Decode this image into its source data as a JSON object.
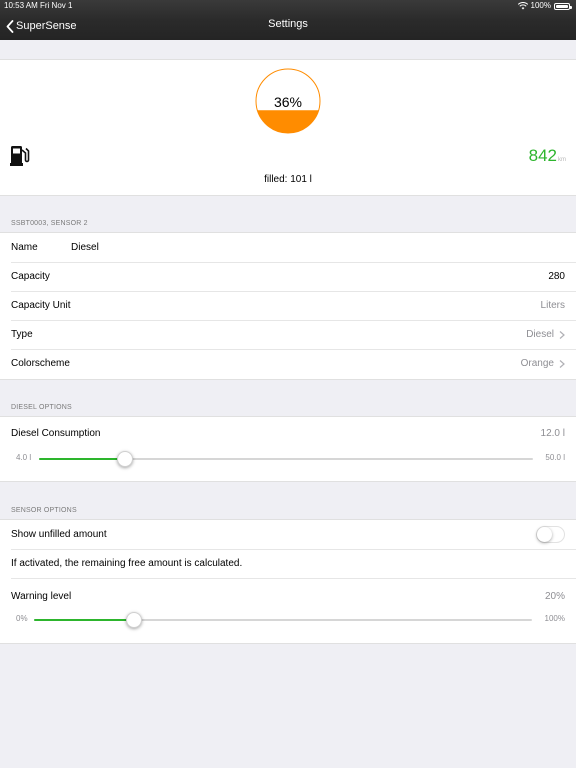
{
  "status_bar": {
    "time": "10:53 AM",
    "date": "Fri Nov 1",
    "battery": "100%"
  },
  "nav": {
    "back_label": "SuperSense",
    "title": "Settings"
  },
  "gauge": {
    "percent_label": "36%",
    "fill_fraction": 0.36,
    "color": "#ff8c00"
  },
  "range": {
    "value": "842",
    "unit": "km"
  },
  "filled_label": "filled: 101 l",
  "sensor_section": {
    "header": "SSBT0003, SENSOR 2",
    "rows": [
      {
        "label": "Name",
        "value": "Diesel"
      },
      {
        "label": "Capacity",
        "value": "280"
      },
      {
        "label": "Capacity Unit",
        "value": "Liters"
      },
      {
        "label": "Type",
        "value": "Diesel"
      },
      {
        "label": "Colorscheme",
        "value": "Orange"
      }
    ]
  },
  "diesel_section": {
    "header": "DIESEL OPTIONS",
    "consumption_label": "Diesel Consumption",
    "consumption_value": "12.0 l",
    "min_label": "4.0 l",
    "max_label": "50.0 l",
    "slider_fraction": 0.174
  },
  "sensor_options": {
    "header": "SENSOR OPTIONS",
    "toggle_label": "Show unfilled amount",
    "toggle_on": false,
    "description": "If activated, the remaining free amount is calculated.",
    "warning_label": "Warning level",
    "warning_value": "20%",
    "min_label": "0%",
    "max_label": "100%",
    "slider_fraction": 0.2
  },
  "colors": {
    "accent_green": "#2db52d",
    "gauge_orange": "#ff8c00"
  }
}
